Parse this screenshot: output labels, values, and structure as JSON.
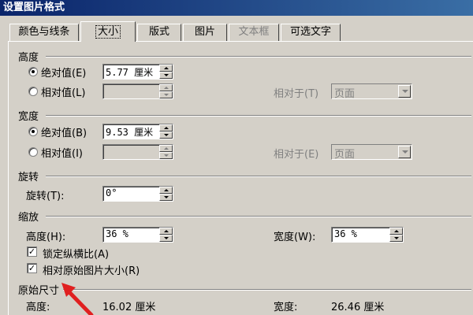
{
  "window": {
    "title": "设置图片格式"
  },
  "tabs": [
    {
      "label": "颜色与线条",
      "state": "normal"
    },
    {
      "label": "大小",
      "state": "active"
    },
    {
      "label": "版式",
      "state": "normal"
    },
    {
      "label": "图片",
      "state": "normal"
    },
    {
      "label": "文本框",
      "state": "disabled"
    },
    {
      "label": "可选文字",
      "state": "normal"
    }
  ],
  "height_section": {
    "title": "高度",
    "absolute_label": "绝对值(E)",
    "absolute_value": "5.77 厘米",
    "relative_label": "相对值(L)",
    "relative_to_label": "相对于(T)",
    "relative_to_value": "页面"
  },
  "width_section": {
    "title": "宽度",
    "absolute_label": "绝对值(B)",
    "absolute_value": "9.53 厘米",
    "relative_label": "相对值(I)",
    "relative_to_label": "相对于(E)",
    "relative_to_value": "页面"
  },
  "rotate_section": {
    "title": "旋转",
    "label": "旋转(T):",
    "value": "0°"
  },
  "scale_section": {
    "title": "缩放",
    "height_label": "高度(H):",
    "height_value": "36 %",
    "width_label": "宽度(W):",
    "width_value": "36 %",
    "lock_aspect_label": "锁定纵横比(A)",
    "lock_aspect_checked": true,
    "relative_original_label": "相对原始图片大小(R)",
    "relative_original_checked": true
  },
  "original_section": {
    "title": "原始尺寸",
    "height_label": "高度:",
    "height_value": "16.02 厘米",
    "width_label": "宽度:",
    "width_value": "26.46 厘米"
  },
  "colors": {
    "annotation_arrow": "#e02020",
    "title_bar": "#0a246a"
  }
}
